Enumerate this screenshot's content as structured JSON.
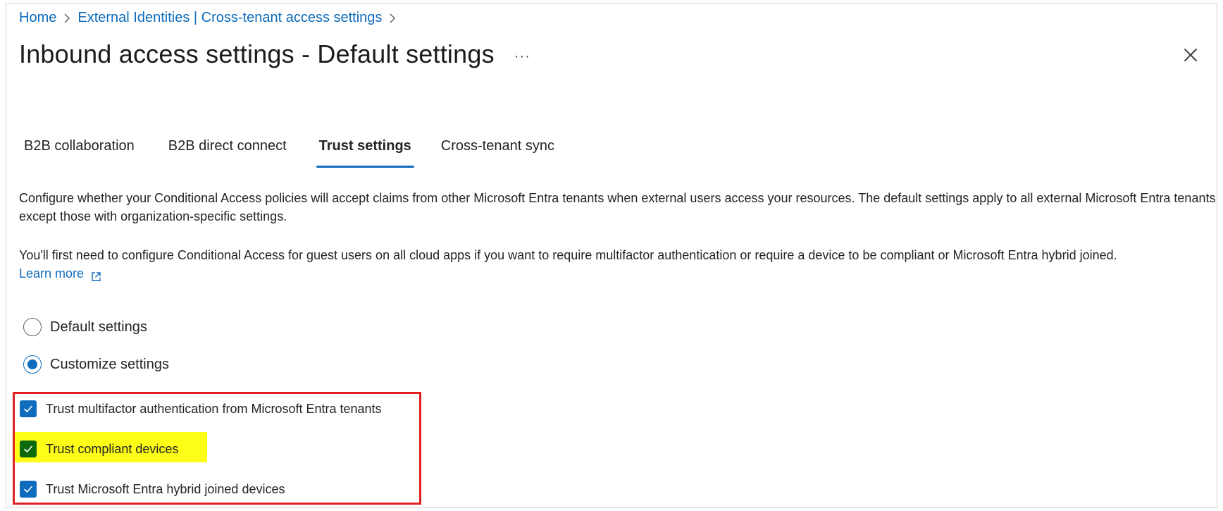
{
  "breadcrumb": {
    "home": "Home",
    "separator": ">",
    "parent": "External Identities | Cross-tenant access settings"
  },
  "header": {
    "title": "Inbound access settings - Default settings",
    "more_label": "···",
    "close_icon": "close-icon"
  },
  "tabs": [
    {
      "label": "B2B collaboration",
      "selected": false
    },
    {
      "label": "B2B direct connect",
      "selected": false
    },
    {
      "label": "Trust settings",
      "selected": true
    },
    {
      "label": "Cross-tenant sync",
      "selected": false
    }
  ],
  "description": {
    "paragraph1": "Configure whether your Conditional Access policies will accept claims from other Microsoft Entra tenants when external users access your resources. The default settings apply to all external Microsoft Entra tenants except those with organization-specific settings.",
    "paragraph2": "You'll first need to configure Conditional Access for guest users on all cloud apps if you want to require multifactor authentication or require a device to be compliant or Microsoft Entra hybrid joined.",
    "learn_more": "Learn more"
  },
  "options": {
    "default_settings": {
      "label": "Default settings",
      "selected": false
    },
    "customize_settings": {
      "label": "Customize settings",
      "selected": true
    }
  },
  "trust_checkboxes": [
    {
      "label": "Trust multifactor authentication from Microsoft Entra tenants",
      "checked": true
    },
    {
      "label": "Trust compliant devices",
      "checked": true,
      "highlighted": true
    },
    {
      "label": "Trust Microsoft Entra hybrid joined devices",
      "checked": true
    }
  ],
  "colors": {
    "accent": "#0f6cbd",
    "annotation_border": "#e02020",
    "annotation_highlight": "#fdfd17",
    "highlighted_checkbox": "#0b6a0b"
  }
}
